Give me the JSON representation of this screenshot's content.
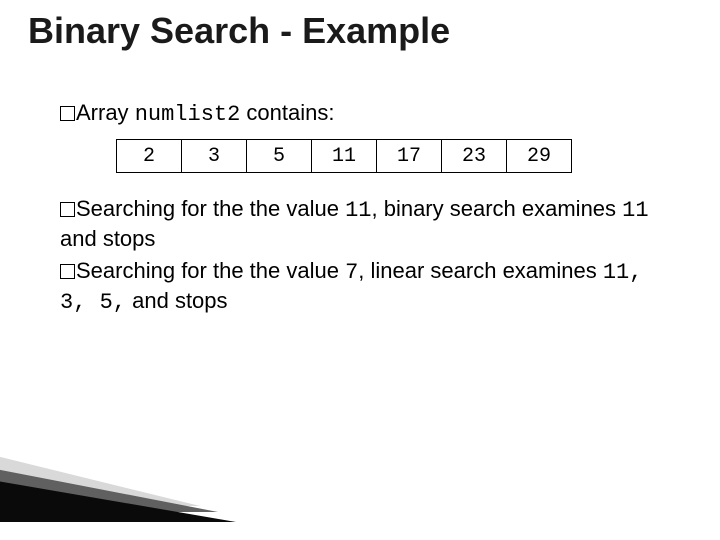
{
  "title": "Binary Search - Example",
  "line1": {
    "word_array": "Array",
    "varname": "numlist2",
    "tail": " contains:"
  },
  "array": [
    "2",
    "3",
    "5",
    "11",
    "17",
    "23",
    "29"
  ],
  "para1": {
    "lead": "Searching",
    "t1": " for the the value ",
    "v1": "11",
    "t2": ", binary search examines ",
    "v2": "11",
    "t3": " and stops"
  },
  "para2": {
    "lead": "Searching",
    "t1": " for the the value ",
    "v1": "7",
    "t2": ", linear search examines ",
    "seq": "11, 3, 5,",
    "t3": " and stops"
  }
}
